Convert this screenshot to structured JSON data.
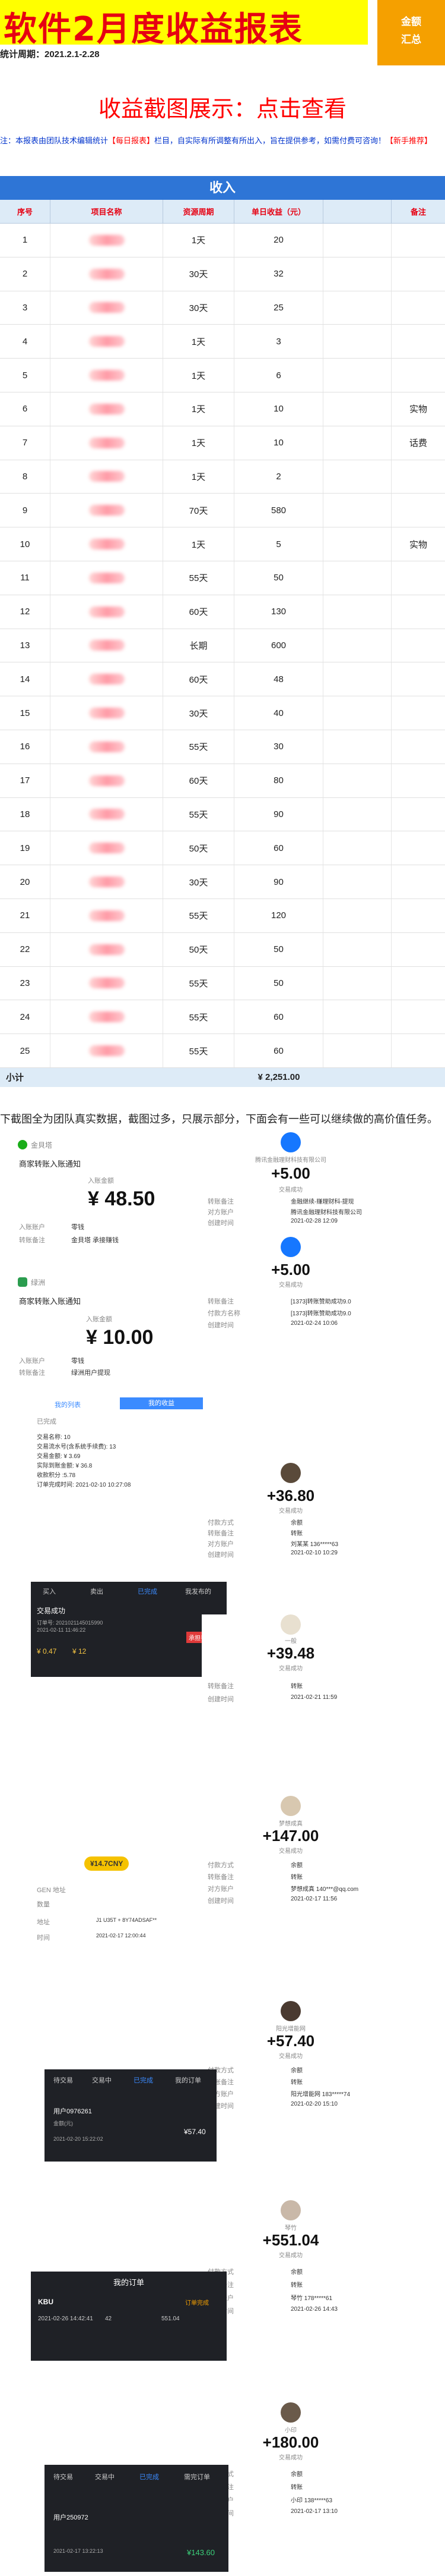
{
  "header": {
    "title": "软件2月度收益报表",
    "badge_line1": "金额",
    "badge_line2": "汇总",
    "date_range": "统计周期：2021.2.1-2.28"
  },
  "subtitle": "收益截图展示：点击查看",
  "notice": {
    "part1": "注：本报表由团队技术编辑统计",
    "part2": "【每日报表】",
    "part3": "栏目，自实际有所调整有所出入，旨在提供参考，如需付费可咨询！",
    "part4": "【新手推荐】"
  },
  "table": {
    "section_title": "收入",
    "columns": [
      "序号",
      "项目名称",
      "资源周期",
      "单日收益（元）",
      "备注"
    ],
    "rows": [
      {
        "no": "1",
        "cycle": "1天",
        "income": "20",
        "note": ""
      },
      {
        "no": "2",
        "cycle": "30天",
        "income": "32",
        "note": ""
      },
      {
        "no": "3",
        "cycle": "30天",
        "income": "25",
        "note": ""
      },
      {
        "no": "4",
        "cycle": "1天",
        "income": "3",
        "note": ""
      },
      {
        "no": "5",
        "cycle": "1天",
        "income": "6",
        "note": ""
      },
      {
        "no": "6",
        "cycle": "1天",
        "income": "10",
        "note": "实物"
      },
      {
        "no": "7",
        "cycle": "1天",
        "income": "10",
        "note": "话费"
      },
      {
        "no": "8",
        "cycle": "1天",
        "income": "2",
        "note": ""
      },
      {
        "no": "9",
        "cycle": "70天",
        "income": "580",
        "note": ""
      },
      {
        "no": "10",
        "cycle": "1天",
        "income": "5",
        "note": "实物"
      },
      {
        "no": "11",
        "cycle": "55天",
        "income": "50",
        "note": ""
      },
      {
        "no": "12",
        "cycle": "60天",
        "income": "130",
        "note": ""
      },
      {
        "no": "13",
        "cycle": "长期",
        "income": "600",
        "note": ""
      },
      {
        "no": "14",
        "cycle": "60天",
        "income": "48",
        "note": ""
      },
      {
        "no": "15",
        "cycle": "30天",
        "income": "40",
        "note": ""
      },
      {
        "no": "16",
        "cycle": "55天",
        "income": "30",
        "note": ""
      },
      {
        "no": "17",
        "cycle": "60天",
        "income": "80",
        "note": ""
      },
      {
        "no": "18",
        "cycle": "55天",
        "income": "90",
        "note": ""
      },
      {
        "no": "19",
        "cycle": "50天",
        "income": "60",
        "note": ""
      },
      {
        "no": "20",
        "cycle": "30天",
        "income": "90",
        "note": ""
      },
      {
        "no": "21",
        "cycle": "55天",
        "income": "120",
        "note": ""
      },
      {
        "no": "22",
        "cycle": "50天",
        "income": "50",
        "note": ""
      },
      {
        "no": "23",
        "cycle": "55天",
        "income": "50",
        "note": ""
      },
      {
        "no": "24",
        "cycle": "55天",
        "income": "60",
        "note": ""
      },
      {
        "no": "25",
        "cycle": "55天",
        "income": "60",
        "note": ""
      }
    ],
    "total_label": "小计",
    "total_value": "¥ 2,251.00"
  },
  "bottom_note": "下截图全为团队真实数据，截图过多，只展示部分，下面会有一些可以继续做的高价值任务。",
  "shots": {
    "s1": {
      "brand": "金貝塔",
      "title": "商家转账入账通知",
      "amount_label": "入账金额",
      "amount": "¥ 48.50",
      "k1": "入账账户",
      "v1": "零钱",
      "k2": "转账备注",
      "v2": "金貝塔 承接赚钱"
    },
    "s2": {
      "name": "腾讯金融理财科技有限公司",
      "amount": "+5.00",
      "status": "交易成功",
      "k1": "转账备注",
      "v1": "金融继续-赚理财科-提现",
      "k2": "对方账户",
      "v2": "腾讯金融理财科技有限公司",
      "k3": "创建时间",
      "v3": "2021-02-28 12:09"
    },
    "s3": {
      "amount": "+5.00",
      "status": "交易成功",
      "k1": "转账备注",
      "v1": "[1373]转账赞助成功9.0",
      "k2": "付款方名称",
      "v2": "[1373]转账赞助成功9.0",
      "k3": "创建时间",
      "v3": "2021-02-24 10:06"
    },
    "s4": {
      "brand": "绿洲",
      "title": "商家转账入账通知",
      "amount_label": "入账金额",
      "amount": "¥ 10.00",
      "k1": "入账账户",
      "v1": "零钱",
      "k2": "转账备注",
      "v2": "绿洲用户提现"
    },
    "s5": {
      "tab1": "我的列表",
      "tab2": "我的收益",
      "status": "已完成",
      "l1": "交易名称: 10",
      "l2": "交易流水号(含系统手续费): 13",
      "l3": "交易金额: ¥ 3.69",
      "l4": "实际到账金额: ¥ 36.8",
      "l5": "收款积分 :5.78",
      "l6": "订单完成时间: 2021-02-10 10:27:08"
    },
    "s6": {
      "amount": "+36.80",
      "status": "交易成功",
      "k1": "付款方式",
      "v1": "余额",
      "k2": "转账备注",
      "v2": "转账",
      "k3": "对方账户",
      "v3": "刘某某 136*****63",
      "k4": "创建时间",
      "v4": "2021-02-10 10:29"
    },
    "s7": {
      "tab1": "买入",
      "tab2": "卖出",
      "tab3": "已完成",
      "tab4": "我发布的",
      "title": "交易成功",
      "l1": "订单号: 2021021145015990",
      "l2": "2021-02-11 11:46:22",
      "badge": "承担手续费",
      "v1": "¥ 0.47",
      "v2": "¥ 12"
    },
    "s8": {
      "name": "一般",
      "amount": "+39.48",
      "status": "交易成功",
      "k1": "转账备注",
      "v1": "转账",
      "k2": "创建时间",
      "v2": "2021-02-21 11:59"
    },
    "s9": {
      "tag": "¥14.7CNY",
      "l1": "GEN 地址",
      "l2": "数量",
      "l3": "地址",
      "v3": "J1 U35T + 8Y74ADSAF**",
      "l4": "时间",
      "v4": "2021-02-17 12:00:44"
    },
    "s10": {
      "name": "梦想成真",
      "amount": "+147.00",
      "status": "交易成功",
      "k1": "付款方式",
      "v1": "余额",
      "k2": "转账备注",
      "v2": "转账",
      "k3": "对方账户",
      "v3": "梦想成真 140***@qq.com",
      "k4": "创建时间",
      "v4": "2021-02-17 11:56"
    },
    "s11": {
      "name": "阳光增能网",
      "amount": "+57.40",
      "status": "交易成功",
      "k1": "付款方式",
      "v1": "余额",
      "k2": "转账备注",
      "v2": "转账",
      "k3": "对方账户",
      "v3": "阳光增能网 183*****74",
      "k4": "创建时间",
      "v4": "2021-02-20 15:10"
    },
    "s12": {
      "tab1": "待交易",
      "tab2": "交易中",
      "tab3": "已完成",
      "tab4": "我的订单",
      "l1": "用户0976261",
      "l2": "金额(元)",
      "v2": "¥57.40",
      "l3": "2021-02-20 15:22:02"
    },
    "s13": {
      "name": "琴竹",
      "amount": "+551.04",
      "status": "交易成功",
      "k1": "付款方式",
      "v1": "余额",
      "k2": "转账备注",
      "v2": "转账",
      "k3": "对方账户",
      "v3": "琴竹 178*****61",
      "k4": "创建时间",
      "v4": "2021-02-26 14:43"
    },
    "s14": {
      "title": "我的订单",
      "brand": "KBU",
      "status": "订单完成",
      "c1": "2021-02-26 14:42:41",
      "c2": "42",
      "c3": "551.04"
    },
    "s15": {
      "name": "小印",
      "amount": "+180.00",
      "status": "交易成功",
      "k1": "付款方式",
      "v1": "余额",
      "k2": "转账备注",
      "v2": "转账",
      "k3": "对方账户",
      "v3": "小印 138*****63",
      "k4": "创建时间",
      "v4": "2021-02-17 13:10"
    },
    "s16": {
      "tab1": "待交易",
      "tab2": "交易中",
      "tab3": "已完成",
      "tab4": "需完订单",
      "l1": "用户250972",
      "l2": "2021-02-17 13:22:13",
      "v2": "¥143.60"
    }
  }
}
